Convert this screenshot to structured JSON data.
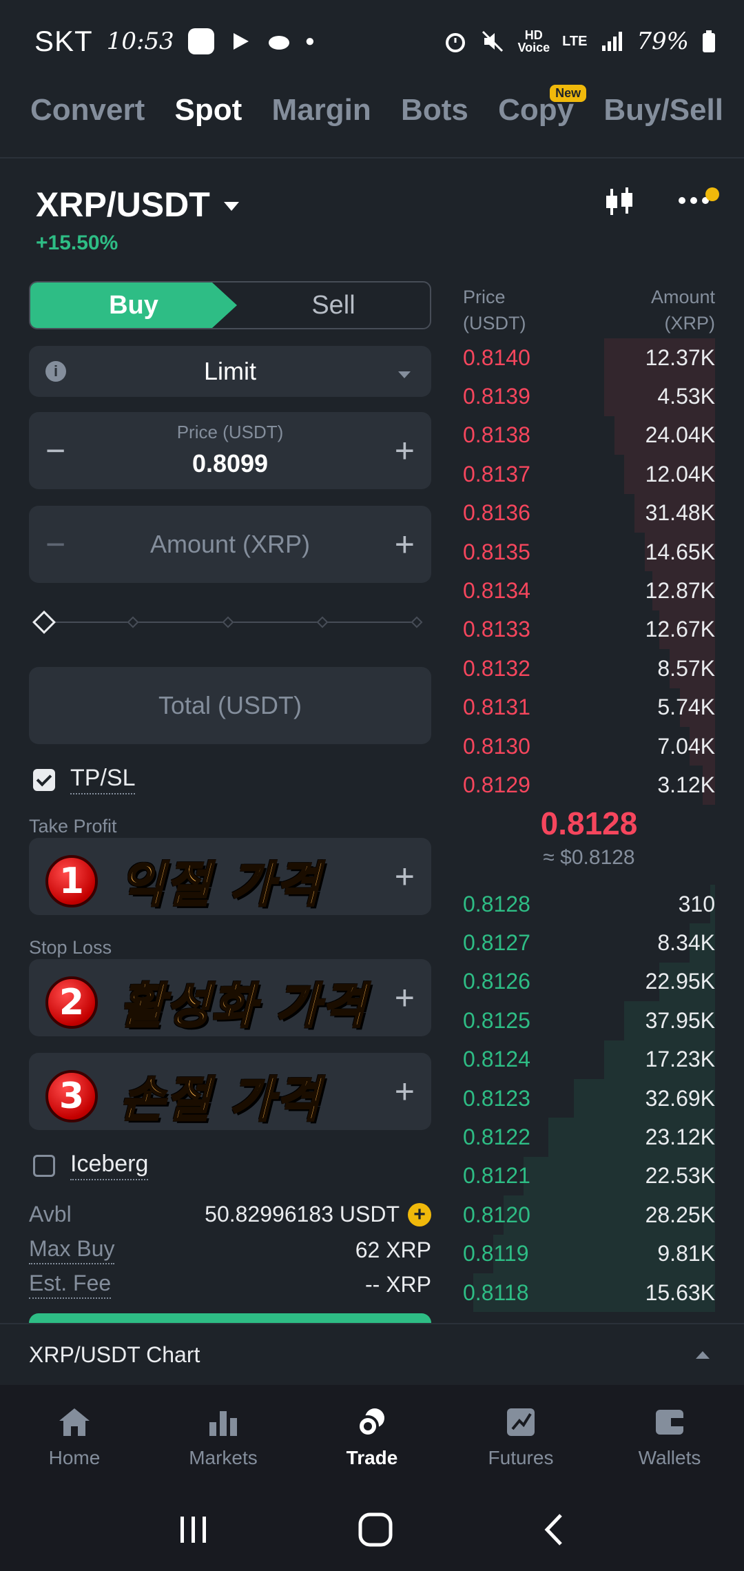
{
  "status_bar": {
    "carrier": "SKT",
    "time": "10:53",
    "battery": "79%",
    "network": "LTE"
  },
  "tabs": [
    {
      "label": "Convert",
      "active": false
    },
    {
      "label": "Spot",
      "active": true
    },
    {
      "label": "Margin",
      "active": false
    },
    {
      "label": "Bots",
      "active": false
    },
    {
      "label": "Copy",
      "active": false,
      "badge": "New"
    },
    {
      "label": "Buy/Sell",
      "active": false
    }
  ],
  "pair": {
    "symbol": "XRP/USDT",
    "change": "+15.50%"
  },
  "order_form": {
    "buy_label": "Buy",
    "sell_label": "Sell",
    "order_type": "Limit",
    "price_label": "Price (USDT)",
    "price_value": "0.8099",
    "amount_placeholder": "Amount (XRP)",
    "total_placeholder": "Total (USDT)",
    "tpsl_label": "TP/SL",
    "take_profit_label": "Take Profit",
    "stop_loss_label": "Stop Loss",
    "iceberg_label": "Iceberg",
    "avbl_label": "Avbl",
    "avbl_value": "50.82996183 USDT",
    "max_buy_label": "Max Buy",
    "max_buy_value": "62 XRP",
    "est_fee_label": "Est. Fee",
    "est_fee_value": "-- XRP"
  },
  "annotations": [
    {
      "number": "1",
      "text": "익절 가격"
    },
    {
      "number": "2",
      "text": "활성화 가격"
    },
    {
      "number": "3",
      "text": "손절 가격"
    }
  ],
  "order_book": {
    "price_header": "Price",
    "price_unit": "(USDT)",
    "amount_header": "Amount",
    "amount_unit": "(XRP)",
    "asks": [
      {
        "price": "0.8140",
        "amount": "12.37K",
        "depth": 0.44
      },
      {
        "price": "0.8139",
        "amount": "4.53K",
        "depth": 0.44
      },
      {
        "price": "0.8138",
        "amount": "24.04K",
        "depth": 0.4
      },
      {
        "price": "0.8137",
        "amount": "12.04K",
        "depth": 0.36
      },
      {
        "price": "0.8136",
        "amount": "31.48K",
        "depth": 0.32
      },
      {
        "price": "0.8135",
        "amount": "14.65K",
        "depth": 0.28
      },
      {
        "price": "0.8134",
        "amount": "12.87K",
        "depth": 0.25
      },
      {
        "price": "0.8133",
        "amount": "12.67K",
        "depth": 0.22
      },
      {
        "price": "0.8132",
        "amount": "8.57K",
        "depth": 0.18
      },
      {
        "price": "0.8131",
        "amount": "5.74K",
        "depth": 0.14
      },
      {
        "price": "0.8130",
        "amount": "7.04K",
        "depth": 0.1
      },
      {
        "price": "0.8129",
        "amount": "3.12K",
        "depth": 0.05
      }
    ],
    "last_price": "0.8128",
    "last_price_usd": "≈ $0.8128",
    "bids": [
      {
        "price": "0.8128",
        "amount": "310",
        "depth": 0.02
      },
      {
        "price": "0.8127",
        "amount": "8.34K",
        "depth": 0.1
      },
      {
        "price": "0.8126",
        "amount": "22.95K",
        "depth": 0.22
      },
      {
        "price": "0.8125",
        "amount": "37.95K",
        "depth": 0.36
      },
      {
        "price": "0.8124",
        "amount": "17.23K",
        "depth": 0.44
      },
      {
        "price": "0.8123",
        "amount": "32.69K",
        "depth": 0.56
      },
      {
        "price": "0.8122",
        "amount": "23.12K",
        "depth": 0.66
      },
      {
        "price": "0.8121",
        "amount": "22.53K",
        "depth": 0.76
      },
      {
        "price": "0.8120",
        "amount": "28.25K",
        "depth": 0.84
      },
      {
        "price": "0.8119",
        "amount": "9.81K",
        "depth": 0.88
      },
      {
        "price": "0.8118",
        "amount": "15.63K",
        "depth": 0.96
      }
    ]
  },
  "chart_bar": {
    "label": "XRP/USDT Chart"
  },
  "bottom_nav": [
    {
      "label": "Home",
      "icon": "home-icon",
      "active": false
    },
    {
      "label": "Markets",
      "icon": "markets-icon",
      "active": false
    },
    {
      "label": "Trade",
      "icon": "trade-icon",
      "active": true
    },
    {
      "label": "Futures",
      "icon": "futures-icon",
      "active": false
    },
    {
      "label": "Wallets",
      "icon": "wallet-icon",
      "active": false
    }
  ],
  "colors": {
    "background": "#1e2329",
    "buy_green": "#2ebd85",
    "sell_red": "#f6465d",
    "accent_yellow": "#f0b90b"
  }
}
